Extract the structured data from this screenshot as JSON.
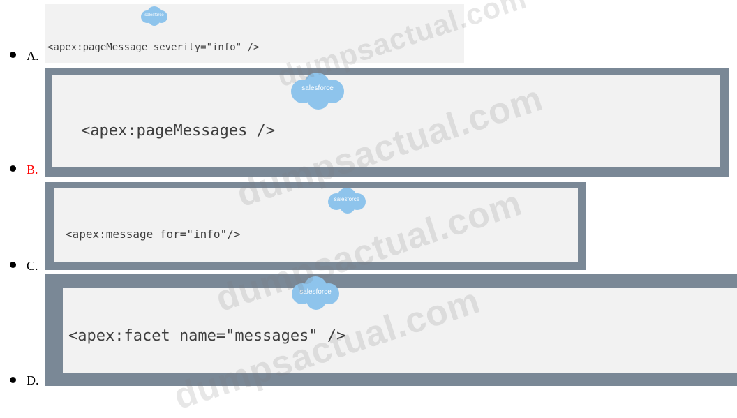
{
  "options": [
    {
      "letter": "A.",
      "code": "<apex:pageMessage severity=\"info\" />",
      "logo": "salesforce",
      "correct": false
    },
    {
      "letter": "B.",
      "code": "<apex:pageMessages />",
      "logo": "salesforce",
      "correct": true
    },
    {
      "letter": "C.",
      "code": "<apex:message for=\"info\"/>",
      "logo": "salesforce",
      "correct": false
    },
    {
      "letter": "D.",
      "code": "<apex:facet name=\"messages\" />",
      "logo": "salesforce",
      "correct": false
    }
  ],
  "watermark": "dumpsactual.com",
  "colors": {
    "frame": "#7a8896",
    "panel": "#f2f2f2",
    "correct_letter": "#ff0000",
    "logo": "#8ec4ec"
  }
}
